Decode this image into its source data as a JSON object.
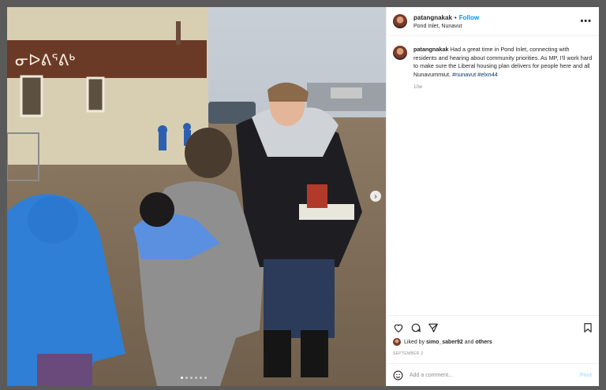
{
  "post": {
    "username": "patangnakak",
    "separator": "•",
    "follow_label": "Follow",
    "location": "Pond Inlet, Nunavut",
    "more_label": "•••",
    "caption_user": "patangnakak",
    "caption_text": "Had a great time in Pond Inlet, connecting with residents and hearing about community priorities. As MP, I'll work hard to make sure the Liberal housing plan delivers for people here and all Nunavummiut.",
    "hashtag_1": "#nunavut",
    "hashtag_2": "#elxn44",
    "time_ago": "10w",
    "liked_by_prefix": "Liked by",
    "liked_by_user": "simo_saber92",
    "liked_by_and": "and",
    "liked_by_others": "others",
    "date": "SEPTEMBER 2",
    "comment_placeholder": "Add a comment...",
    "post_label": "Post",
    "building_sign": "ᓂᐅᕕᕐᕕᒃ",
    "carousel": {
      "slides": 6,
      "active": 1
    }
  },
  "icons": [
    "heart-icon",
    "comment-icon",
    "share-icon",
    "bookmark-icon",
    "emoji-icon",
    "next-arrow-icon",
    "more-icon"
  ]
}
